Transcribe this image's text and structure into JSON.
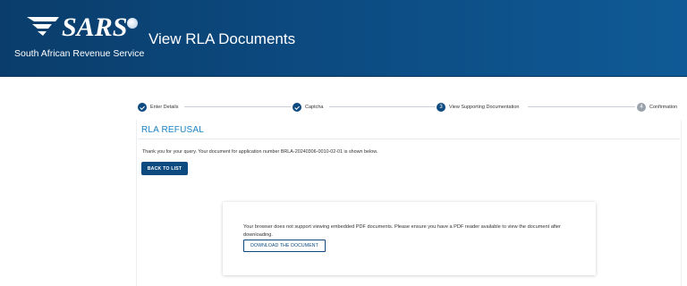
{
  "header": {
    "logo_text": "SARS",
    "org_name": "South African Revenue Service",
    "page_title": "View RLA Documents",
    "color": "#0c4a80"
  },
  "stepper": {
    "steps": [
      {
        "label": "Enter Details",
        "number": "1",
        "state": "done"
      },
      {
        "label": "Captcha",
        "number": "2",
        "state": "done"
      },
      {
        "label": "View Supporting Documentation",
        "number": "3",
        "state": "active"
      },
      {
        "label": "Confirmation",
        "number": "4",
        "state": "pending"
      }
    ]
  },
  "main": {
    "section_title": "RLA REFUSAL",
    "intro_text": "Thank you for your query. Your document for application number BRLA-20240306-0010-02-01 is shown below.",
    "back_button": "BACK TO LIST",
    "accent_color": "#1a82c4"
  },
  "pdf_viewer": {
    "message": "Your browser does not support viewing embedded PDF documents. Please ensure you have a PDF reader available to view the document after downloading.",
    "download_button": "DOWNLOAD THE DOCUMENT"
  }
}
